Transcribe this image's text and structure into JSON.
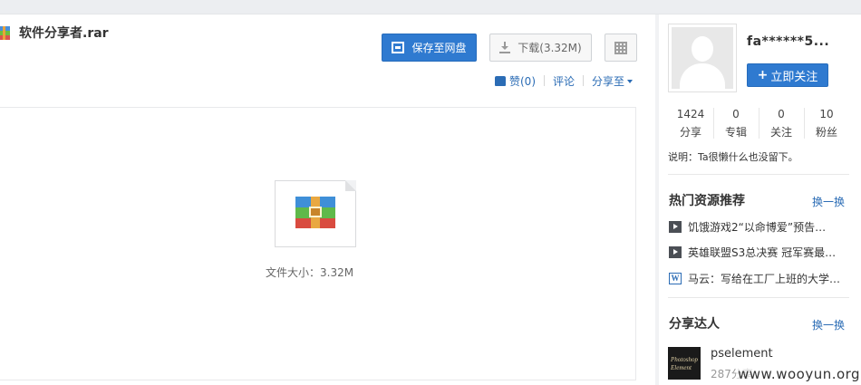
{
  "file": {
    "name": "软件分享者.rar",
    "size_text": "文件大小：3.32M"
  },
  "toolbar": {
    "save_label": "保存至网盘",
    "download_label": "下载(3.32M)"
  },
  "actions": {
    "like_label": "赞(0)",
    "comment_label": "评论",
    "share_label": "分享至"
  },
  "user": {
    "name": "fa******5...",
    "follow_label": "立即关注",
    "stats": [
      {
        "num": "1424",
        "label": "分享"
      },
      {
        "num": "0",
        "label": "专辑"
      },
      {
        "num": "0",
        "label": "关注"
      },
      {
        "num": "10",
        "label": "粉丝"
      }
    ],
    "note": "说明：Ta很懒什么也没留下。"
  },
  "hot": {
    "title": "热门资源推荐",
    "swap_label": "换一换",
    "items": [
      {
        "icon": "video-icon",
        "text": "饥饿游戏2“以命博爱”预告…"
      },
      {
        "icon": "video-icon",
        "text": "英雄联盟S3总决赛 冠军赛最…"
      },
      {
        "icon": "word-doc-icon",
        "text": "马云：写给在工厂上班的大学…"
      }
    ]
  },
  "talent": {
    "title": "分享达人",
    "swap_label": "换一换",
    "name": "pselement",
    "count": "287分享",
    "avatar_text_1": "Photoshop",
    "avatar_text_2": "Element"
  },
  "watermark": "www.wooyun.org",
  "colors": {
    "primary": "#2f7ad0",
    "link": "#2b6cb5",
    "background": "#f1f2f4"
  }
}
